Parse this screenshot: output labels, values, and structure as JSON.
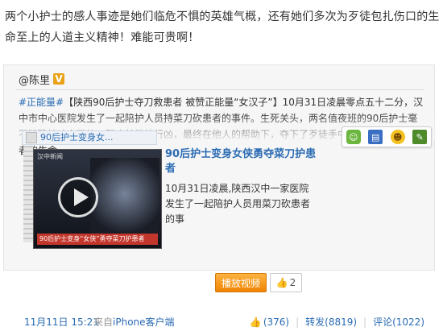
{
  "post": {
    "text": "两个小护士的感人事迹是她们临危不惧的英雄气概，还有她们多次为歹徒包扎伤口的生命至上的人道主义精神！难能可贵啊！"
  },
  "repost": {
    "author": "@陈里",
    "verified_badge": "V",
    "topic": "#正能量#",
    "body": "【陕西90后护士夺刀救患者 被赞正能量“女汉子”】10月31日凌晨零点五十二分，汉中市中心医院发生了一起陪护人员持菜刀砍患者的事件。生死关头，两名值夜班的90后护士毫不犹豫地冲向歹徒，阻止其继续行凶，最终在他人的帮助下，夺下了歹徒手中的菜刀，挽救了患者的生命。",
    "tab_label": "90后护士变身女...",
    "video": {
      "logo": "汉中新闻",
      "caption": "90后护士变身“女侠”勇夺菜刀护患者",
      "title": "90后护士变身女侠勇夺菜刀护患者",
      "desc": "10月31日凌晨,陕西汉中一家医院发生了一起陪护人员用菜刀砍患者的事",
      "play_label": "播放视频",
      "like_count": "2"
    },
    "footer": {
      "time": "11月11日 15:21",
      "from_prefix": "来自",
      "source": "iPhone客户端",
      "likes": "(376)",
      "repost": "转发(8819)",
      "comment": "评论(1022)"
    }
  },
  "emoji_icons": [
    "green-smiley-icon",
    "blue-disk-icon",
    "yellow-face-icon",
    "green-leaf-icon"
  ]
}
